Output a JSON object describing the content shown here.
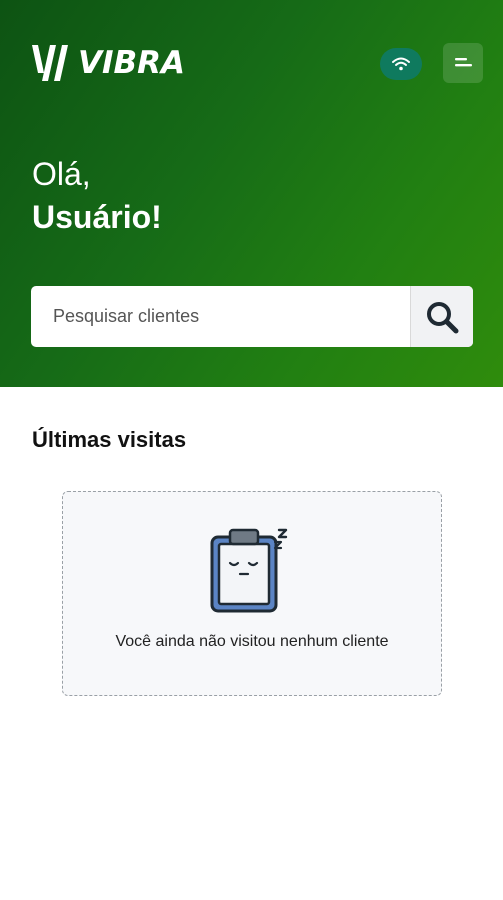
{
  "header": {
    "brand": "VIBRA",
    "greeting_line1": "Olá,",
    "greeting_line2": "Usuário!"
  },
  "search": {
    "placeholder": "Pesquisar clientes"
  },
  "recent_visits": {
    "title": "Últimas visitas",
    "empty_message": "Você ainda não visitou nenhum cliente"
  },
  "colors": {
    "brand_green": "#166b17",
    "status_pill": "#0f7a5e"
  },
  "icons": [
    "vibra-logo-icon",
    "wifi-icon",
    "menu-icon",
    "search-icon",
    "sleeping-clipboard-icon"
  ]
}
